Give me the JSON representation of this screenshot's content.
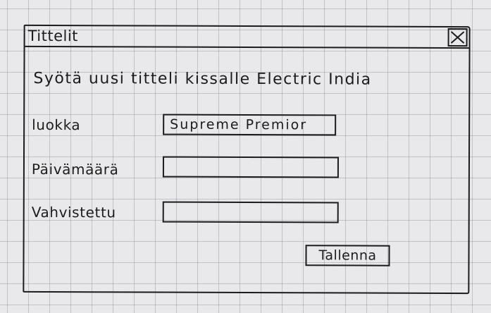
{
  "window": {
    "title": "Tittelit"
  },
  "form": {
    "intro_text": "Syötä uusi titteli kissalle Electric India",
    "fields": [
      {
        "label": "luokka",
        "value": "Supreme Premior",
        "placeholder": ""
      },
      {
        "label": "Päivämäärä",
        "value": "",
        "placeholder": ""
      },
      {
        "label": "Vahvistettu",
        "value": "",
        "placeholder": ""
      }
    ],
    "save_label": "Tallenna"
  },
  "icons": {
    "close": "close-icon"
  },
  "colors": {
    "ink": "#1c1c1c",
    "paper": "#e9e8ea",
    "grid": "#9a9aa2"
  }
}
